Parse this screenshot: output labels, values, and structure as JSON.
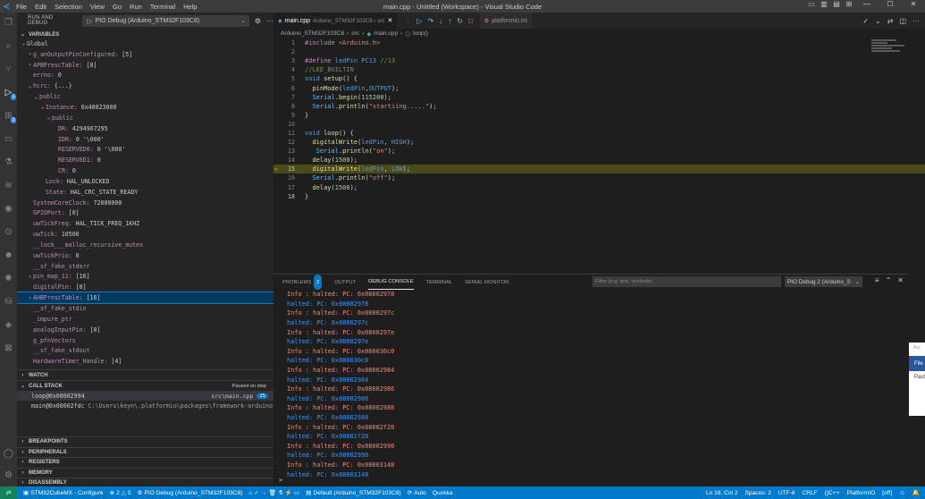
{
  "titlebar": {
    "title": "main.cpp - Untitled (Workspace) - Visual Studio Code",
    "menu": [
      "File",
      "Edit",
      "Selection",
      "View",
      "Go",
      "Run",
      "Terminal",
      "Help"
    ]
  },
  "sidebar": {
    "header": "RUN AND DEBUG",
    "config_select": "PIO Debug (Arduino_STM32F103C8)",
    "variables_title": "VARIABLES",
    "variables": [
      {
        "indent": 0,
        "twisty": "v",
        "name": "Global",
        "value": "",
        "group": true
      },
      {
        "indent": 1,
        "twisty": ">",
        "name": "g_anOutputPinConfigured:",
        "value": "[5]"
      },
      {
        "indent": 1,
        "twisty": ">",
        "name": "APBPrescTable:",
        "value": "[8]"
      },
      {
        "indent": 1,
        "twisty": "",
        "name": "errno:",
        "value": "0"
      },
      {
        "indent": 1,
        "twisty": "v",
        "name": "hcrc:",
        "value": "{...}"
      },
      {
        "indent": 2,
        "twisty": "v",
        "name": "public",
        "value": ""
      },
      {
        "indent": 3,
        "twisty": "v",
        "name": "Instance:",
        "value": "0x40023000"
      },
      {
        "indent": 4,
        "twisty": "v",
        "name": "public",
        "value": ""
      },
      {
        "indent": 5,
        "twisty": "",
        "name": "DR:",
        "value": "4294967295"
      },
      {
        "indent": 5,
        "twisty": "",
        "name": "IDR:",
        "value": "0 '\\000'"
      },
      {
        "indent": 5,
        "twisty": "",
        "name": "RESERVED0:",
        "value": "0 '\\000'"
      },
      {
        "indent": 5,
        "twisty": "",
        "name": "RESERVED1:",
        "value": "0"
      },
      {
        "indent": 5,
        "twisty": "",
        "name": "CR:",
        "value": "0"
      },
      {
        "indent": 3,
        "twisty": "",
        "name": "Lock:",
        "value": "HAL_UNLOCKED"
      },
      {
        "indent": 3,
        "twisty": "",
        "name": "State:",
        "value": "HAL_CRC_STATE_READY"
      },
      {
        "indent": 1,
        "twisty": "",
        "name": "SystemCoreClock:",
        "value": "72000000"
      },
      {
        "indent": 1,
        "twisty": "",
        "name": "GPIOPort:",
        "value": "[0]"
      },
      {
        "indent": 1,
        "twisty": "",
        "name": "uwTickFreq:",
        "value": "HAL_TICK_FREQ_1KHZ"
      },
      {
        "indent": 1,
        "twisty": "",
        "name": "uwTick:",
        "value": "10500"
      },
      {
        "indent": 1,
        "twisty": "",
        "name": "__lock___malloc_recursive_mutex",
        "value": ""
      },
      {
        "indent": 1,
        "twisty": "",
        "name": "uwTickPrio:",
        "value": "0"
      },
      {
        "indent": 1,
        "twisty": "",
        "name": "__sf_fake_stderr",
        "value": ""
      },
      {
        "indent": 1,
        "twisty": ">",
        "name": "pin_map_11:",
        "value": "[16]"
      },
      {
        "indent": 1,
        "twisty": "",
        "name": "digitalPin:",
        "value": "[0]"
      },
      {
        "indent": 1,
        "twisty": ">",
        "name": "AHBPrescTable:",
        "value": "[16]",
        "selected": true
      },
      {
        "indent": 1,
        "twisty": "",
        "name": "__sf_fake_stdin",
        "value": ""
      },
      {
        "indent": 1,
        "twisty": "",
        "name": "_impure_ptr",
        "value": ""
      },
      {
        "indent": 1,
        "twisty": "",
        "name": "analogInputPin:",
        "value": "[0]"
      },
      {
        "indent": 1,
        "twisty": "",
        "name": "g_pfnVectors",
        "value": ""
      },
      {
        "indent": 1,
        "twisty": "",
        "name": "__sf_fake_stdout",
        "value": ""
      },
      {
        "indent": 1,
        "twisty": "",
        "name": "HardwareTimer_Handle:",
        "value": "[4]"
      }
    ],
    "watch_title": "WATCH",
    "callstack_title": "CALL STACK",
    "callstack_status": "Paused on step",
    "frames": [
      {
        "name": "loop@0x08002994",
        "location": "src\\main.cpp",
        "line": "15"
      },
      {
        "name": "main@0x08002fdc",
        "path": "C:\\Users\\keyn\\.platformio\\packages\\framework-arduinoststm"
      }
    ],
    "bottom_sections": [
      "BREAKPOINTS",
      "PERIPHERALS",
      "REGISTERS",
      "MEMORY",
      "DISASSEMBLY"
    ]
  },
  "editor": {
    "tabs": [
      {
        "label": "main.cpp",
        "detail": "Arduino_STM32F103C8 › src",
        "active": true
      },
      {
        "label": "platformio.ini",
        "detail": "",
        "active": false
      }
    ],
    "breadcrumb": [
      "Arduino_STM32F103C8",
      "src",
      "main.cpp",
      "loop()"
    ],
    "current_line": "15"
  },
  "panel": {
    "tabs": [
      "PROBLEMS",
      "OUTPUT",
      "DEBUG CONSOLE",
      "TERMINAL",
      "SERIAL MONITOR"
    ],
    "problems_count": "2",
    "filter_placeholder": "Filter (e.g. text, !exclude)",
    "console_select": "PIO Debug 2 (Arduino_S",
    "console_lines": [
      {
        "type": "info",
        "text": "Info : halted: PC: 0x08002978"
      },
      {
        "type": "halt",
        "text": "halted: PC: 0x08002978"
      },
      {
        "type": "info",
        "text": "Info : halted: PC: 0x0800297c"
      },
      {
        "type": "halt",
        "text": "halted: PC: 0x0800297c"
      },
      {
        "type": "info",
        "text": "Info : halted: PC: 0x0800297e"
      },
      {
        "type": "halt",
        "text": "halted: PC: 0x0800297e"
      },
      {
        "type": "info",
        "text": "Info : halted: PC: 0x080030c0"
      },
      {
        "type": "halt",
        "text": "halted: PC: 0x080030c0"
      },
      {
        "type": "info",
        "text": "Info : halted: PC: 0x08002984"
      },
      {
        "type": "halt",
        "text": "halted: PC: 0x08002984"
      },
      {
        "type": "info",
        "text": "Info : halted: PC: 0x08002986"
      },
      {
        "type": "halt",
        "text": "halted: PC: 0x08002986"
      },
      {
        "type": "info",
        "text": "Info : halted: PC: 0x08002988"
      },
      {
        "type": "halt",
        "text": "halted: PC: 0x08002988"
      },
      {
        "type": "info",
        "text": "Info : halted: PC: 0x08002f20"
      },
      {
        "type": "halt",
        "text": "halted: PC: 0x08002f20"
      },
      {
        "type": "info",
        "text": "Info : halted: PC: 0x08002990"
      },
      {
        "type": "halt",
        "text": "halted: PC: 0x08002990"
      },
      {
        "type": "info",
        "text": "Info : halted: PC: 0x08003148"
      },
      {
        "type": "halt",
        "text": "halted: PC: 0x08003148"
      }
    ],
    "prompt": ">"
  },
  "peek_window": {
    "title": "Au",
    "tab": "File",
    "item": "Past"
  },
  "statusbar": {
    "project": "STM32CubeMX - Configure",
    "errors": "2",
    "warnings": "0",
    "debug": "PIO Debug (Arduino_STM32F103C8)",
    "env": "Default (Arduino_STM32F103C8)",
    "auto": "Auto",
    "quokka": "Quokka",
    "position": "Ln 18, Col 2",
    "spaces": "Spaces: 2",
    "encoding": "UTF-8",
    "eol": "CRLF",
    "language": "C++",
    "platform": "PlatformIO",
    "off": "[off]"
  },
  "colors": {
    "accent": "#007acc",
    "remote": "#16825d",
    "current_line_bg": "#4b4b18"
  }
}
